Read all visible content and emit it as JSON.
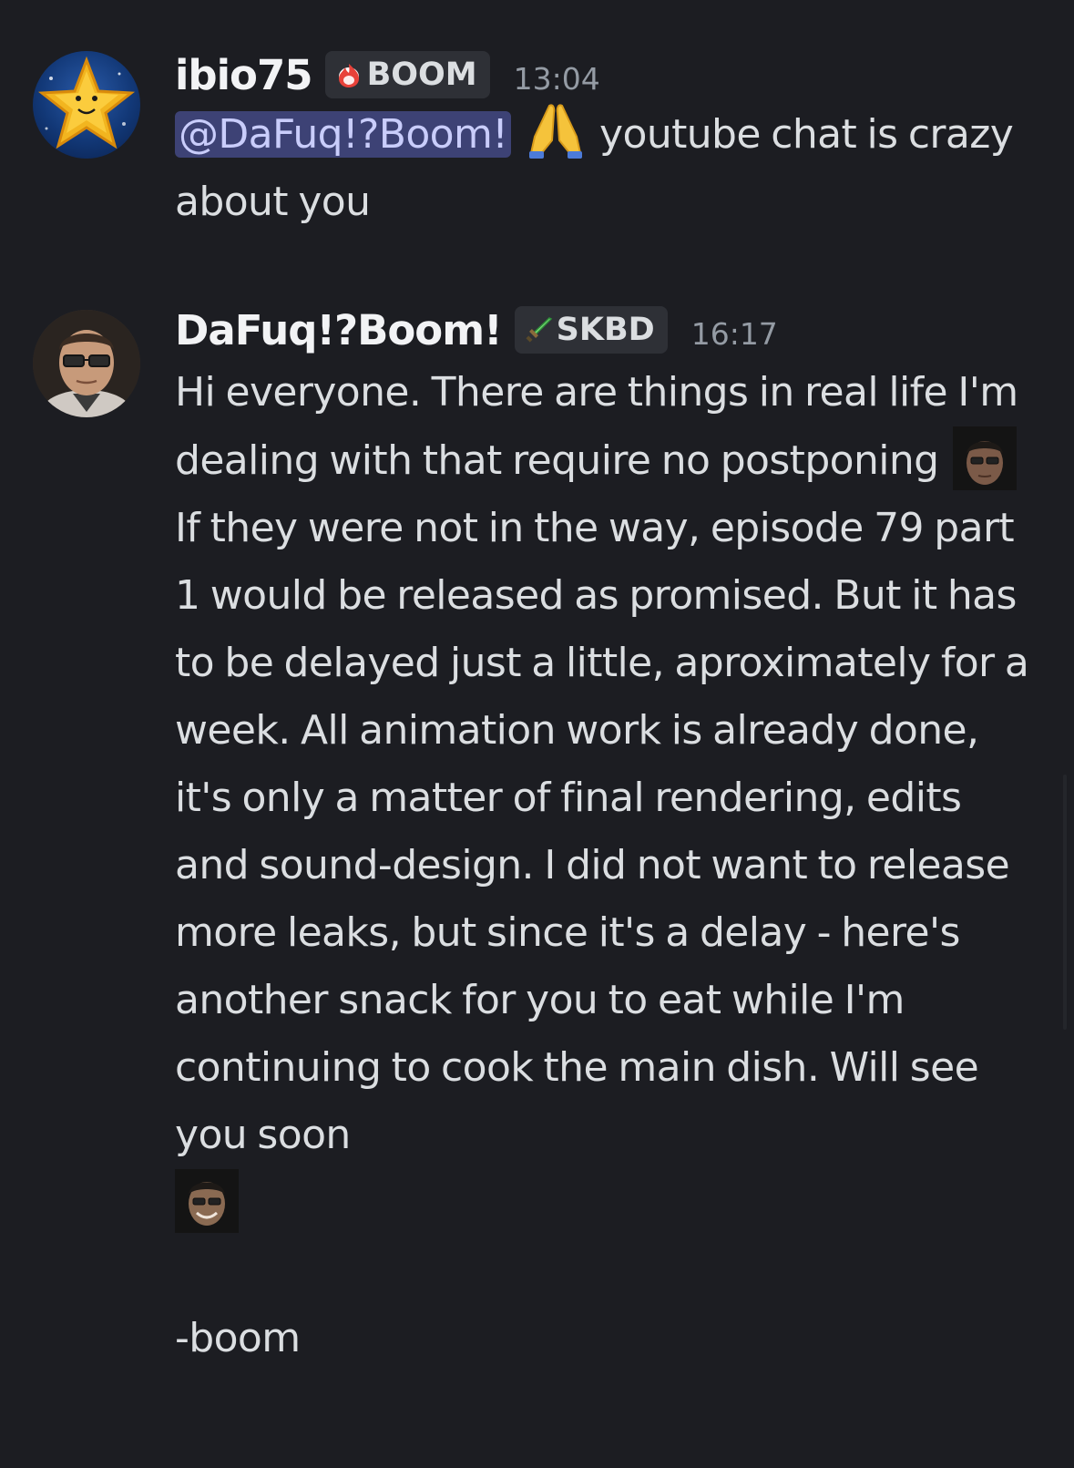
{
  "messages": [
    {
      "username": "ibio75",
      "tag": {
        "label": "BOOM",
        "icon": "flame-icon"
      },
      "timestamp": "13:04",
      "mention": "@DaFuq!?Boom!",
      "emoji": "folded-hands",
      "text_after_mention": " youtube chat is crazy about you"
    },
    {
      "username": "DaFuq!?Boom!",
      "tag": {
        "label": "SKBD",
        "icon": "sword-icon"
      },
      "timestamp": "16:17",
      "text_part1": "Hi everyone. There are things in real life I'm dealing with that require no postponing ",
      "text_part2": " If they were not in the way, episode 79 part 1 would be released as promised. But it has to be delayed just a little, aproximately for a week. All animation work is already done, it's only a matter of final rendering, edits and sound-design. I did not want to release more leaks, but since it's a delay - here's another snack for you to eat while I'm continuing to cook the main dish. Will see you soon",
      "signature": "-boom"
    }
  ],
  "colors": {
    "background": "#1c1d22",
    "text": "#dbdee1",
    "username": "#f2f3f5",
    "timestamp": "#949ba4",
    "mention_bg": "#3d4275",
    "mention_text": "#c9cdfb",
    "tag_bg": "#2e3036"
  }
}
